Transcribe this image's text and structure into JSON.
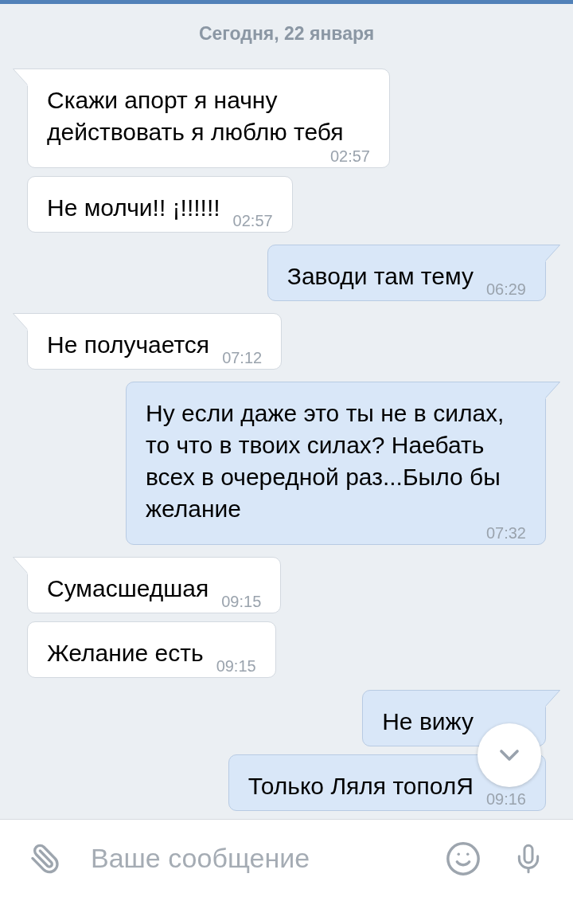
{
  "date_divider": "Сегодня, 22 января",
  "messages": [
    {
      "kind": "incoming",
      "tail": true,
      "text": "Скажи апорт я начну действовать я люблю тебя",
      "time": "02:57"
    },
    {
      "kind": "incoming",
      "tail": false,
      "text": "Не молчи!! ¡!!!!!!",
      "time": "02:57"
    },
    {
      "kind": "outgoing",
      "tail": true,
      "text": "Заводи там тему",
      "time": "06:29"
    },
    {
      "kind": "incoming",
      "tail": true,
      "text": "Не получается",
      "time": "07:12"
    },
    {
      "kind": "outgoing",
      "tail": true,
      "text": "Ну если даже это ты не в силах, то что в твоих силах? Наебать всех в очередной раз...Было бы желание",
      "time": "07:32"
    },
    {
      "kind": "incoming",
      "tail": true,
      "text": "Сумасшедшая",
      "time": "09:15"
    },
    {
      "kind": "incoming",
      "tail": false,
      "text": "Желание есть",
      "time": "09:15"
    },
    {
      "kind": "outgoing",
      "tail": true,
      "text": "Не вижу"
    },
    {
      "kind": "outgoing",
      "tail": false,
      "text": "Только Ляля тополЯ",
      "time": "09:16"
    }
  ],
  "composer": {
    "placeholder": "Ваше сообщение"
  }
}
